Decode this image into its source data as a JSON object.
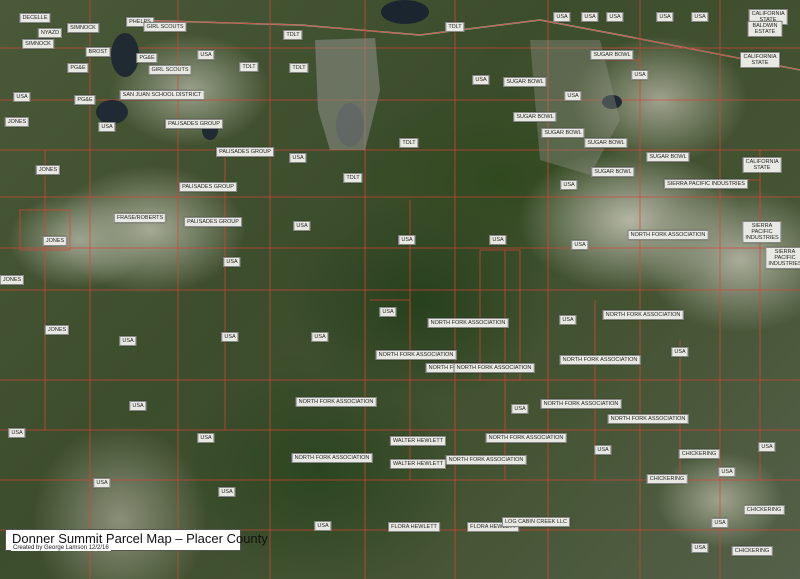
{
  "map": {
    "title": "Donner Summit Parcel Map – Placer County",
    "credit": "Created by George Lamson 12/2/16",
    "labels_row1": [
      "DECELLE",
      "NYAZD",
      "SIMNOCK",
      "SIMNOCK",
      "BROST",
      "PG&E",
      "PHELPS",
      "GIRL SCOUTS",
      "TDLT",
      "TDLT",
      "USA",
      "USA",
      "USA",
      "USA",
      "USA",
      "CALIFORNIA STATE",
      "BALDWIN ESTATE",
      "CALIFORNIA STATE"
    ],
    "labels_row2": [
      "USA",
      "PG&E",
      "PG&E",
      "SAN JUAN SCHOOL DISTRICT",
      "GIRL SCOUTS",
      "USA",
      "TDLT",
      "TDLT",
      "SUGAR BOWL",
      "SUGAR BOWL",
      "USA",
      "USA",
      "USA",
      "PALISADES GROUP",
      "PALISADES GROUP",
      "PALISADES GROUP",
      "PALISADES GROUP",
      "JONES",
      "JONES",
      "USA",
      "TDLT",
      "TDLT",
      "USA"
    ],
    "labels_row3": [
      "SUGAR BOWL",
      "SUGAR BOWL",
      "SUGAR BOWL",
      "SUGAR BOWL",
      "SUGAR BOWL",
      "USA",
      "CALIFORNIA STATE",
      "SIERRA PACIFIC INDUSTRIES",
      "SIERRA PACIFIC INDUSTRIES",
      "SIERRA PACIFIC INDUSTRIES",
      "NORTH FORK ASSOCIATION",
      "FRASE/ROBERTS",
      "JONES",
      "JONES",
      "JONES",
      "USA",
      "USA",
      "USA",
      "USA",
      "USA",
      "USA",
      "USA"
    ],
    "labels_row4": [
      "NORTH FORK ASSOCIATION",
      "NORTH FORK ASSOCIATION",
      "NORTH FORK ASSOCIATION",
      "NORTH FORK ASSOCIATION",
      "NORTH FORK ASSOCIATION",
      "NORTH FORK ASSOCIATION",
      "NORTH FORK ASSOCIATION",
      "NORTH FORK ASSOCIATION",
      "NORTH FORK ASSOCIATION",
      "NORTH FORK ASSOCIATION",
      "NORTH FORK ASSOCIATION",
      "NORTH FORK ASSOCIATION",
      "WALTER HEWLETT",
      "WALTER HEWLETT",
      "FLORA HEWLETT",
      "FLORA HEWLETT",
      "LOG CABIN CREEK LLC",
      "CHICKERING",
      "CHICKERING",
      "CHICKERING",
      "CHICKERING",
      "USA",
      "USA",
      "USA",
      "USA",
      "USA",
      "USA",
      "USA",
      "USA",
      "USA",
      "USA",
      "USA",
      "USA",
      "USA",
      "USA",
      "USA",
      "USA"
    ]
  }
}
